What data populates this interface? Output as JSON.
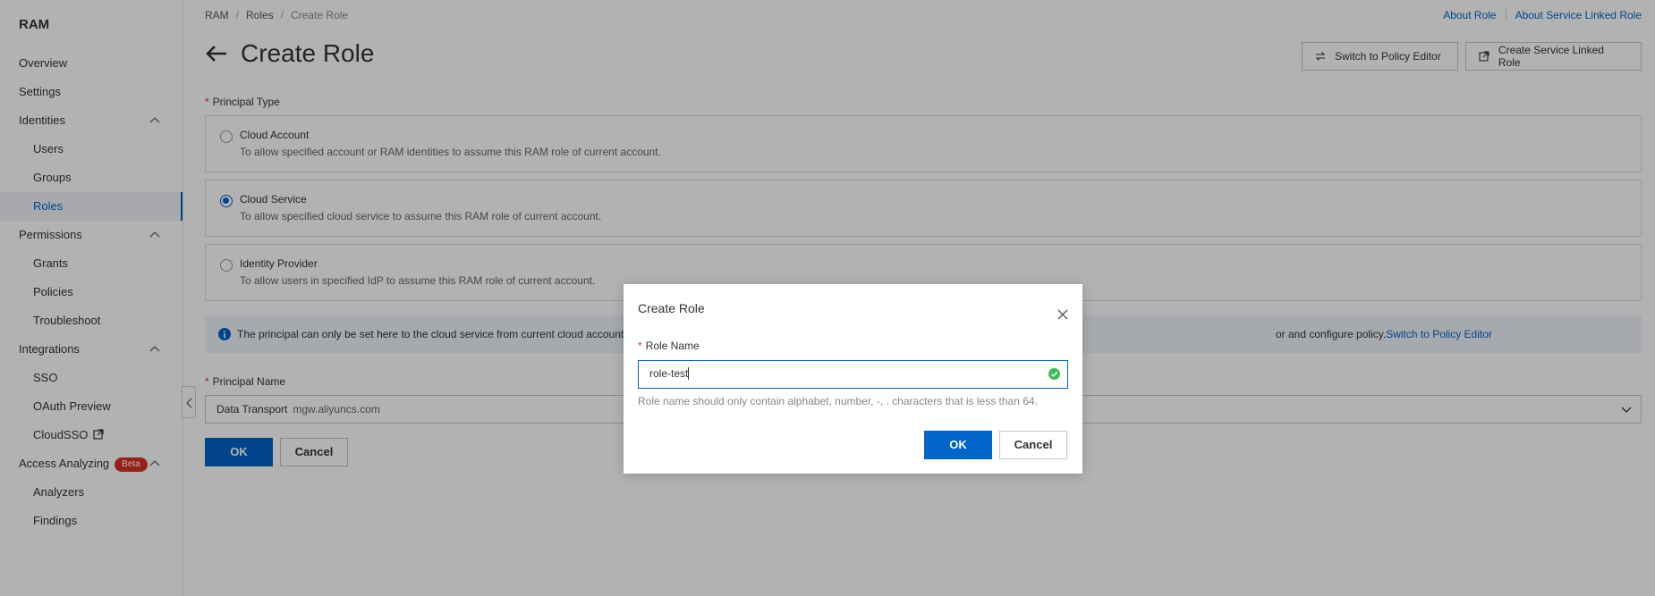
{
  "sidebar": {
    "title": "RAM",
    "overview": "Overview",
    "settings": "Settings",
    "identities": "Identities",
    "users": "Users",
    "groups": "Groups",
    "roles": "Roles",
    "permissions": "Permissions",
    "grants": "Grants",
    "policies": "Policies",
    "troubleshoot": "Troubleshoot",
    "integrations": "Integrations",
    "sso": "SSO",
    "oauth": "OAuth Preview",
    "cloudsso": "CloudSSO",
    "access_analyzing": "Access Analyzing",
    "beta": "Beta",
    "analyzers": "Analyzers",
    "findings": "Findings"
  },
  "breadcrumb": [
    "RAM",
    "Roles",
    "Create Role"
  ],
  "top_links": {
    "about_role": "About Role",
    "about_slr": "About Service Linked Role"
  },
  "page_title": "Create Role",
  "header_buttons": {
    "switch_policy": "Switch to Policy Editor",
    "create_slr": "Create Service Linked Role"
  },
  "principal_type": {
    "label": "Principal Type",
    "options": [
      {
        "title": "Cloud Account",
        "desc": "To allow specified account or RAM identities to assume this RAM role of current account.",
        "selected": false
      },
      {
        "title": "Cloud Service",
        "desc": "To allow specified cloud service to assume this RAM role of current account.",
        "selected": true
      },
      {
        "title": "Identity Provider",
        "desc": "To allow users in specified IdP to assume this RAM role of current account.",
        "selected": false
      }
    ]
  },
  "notice": {
    "text_left": "The principal can only be set here to the cloud service from current cloud account",
    "text_right": "or and configure policy.",
    "link": "Switch to Policy Editor"
  },
  "principal_name": {
    "label": "Principal Name",
    "value": "Data Transport",
    "sub": "mgw.aliyuncs.com"
  },
  "form_buttons": {
    "ok": "OK",
    "cancel": "Cancel"
  },
  "modal": {
    "title": "Create Role",
    "field_label": "Role Name",
    "field_value": "role-test",
    "help": "Role name should only contain alphabet, number, -, . characters that is less than 64.",
    "ok": "OK",
    "cancel": "Cancel"
  },
  "colors": {
    "accent": "#0064c8",
    "required": "#d93026",
    "success": "#3ebc5a"
  }
}
